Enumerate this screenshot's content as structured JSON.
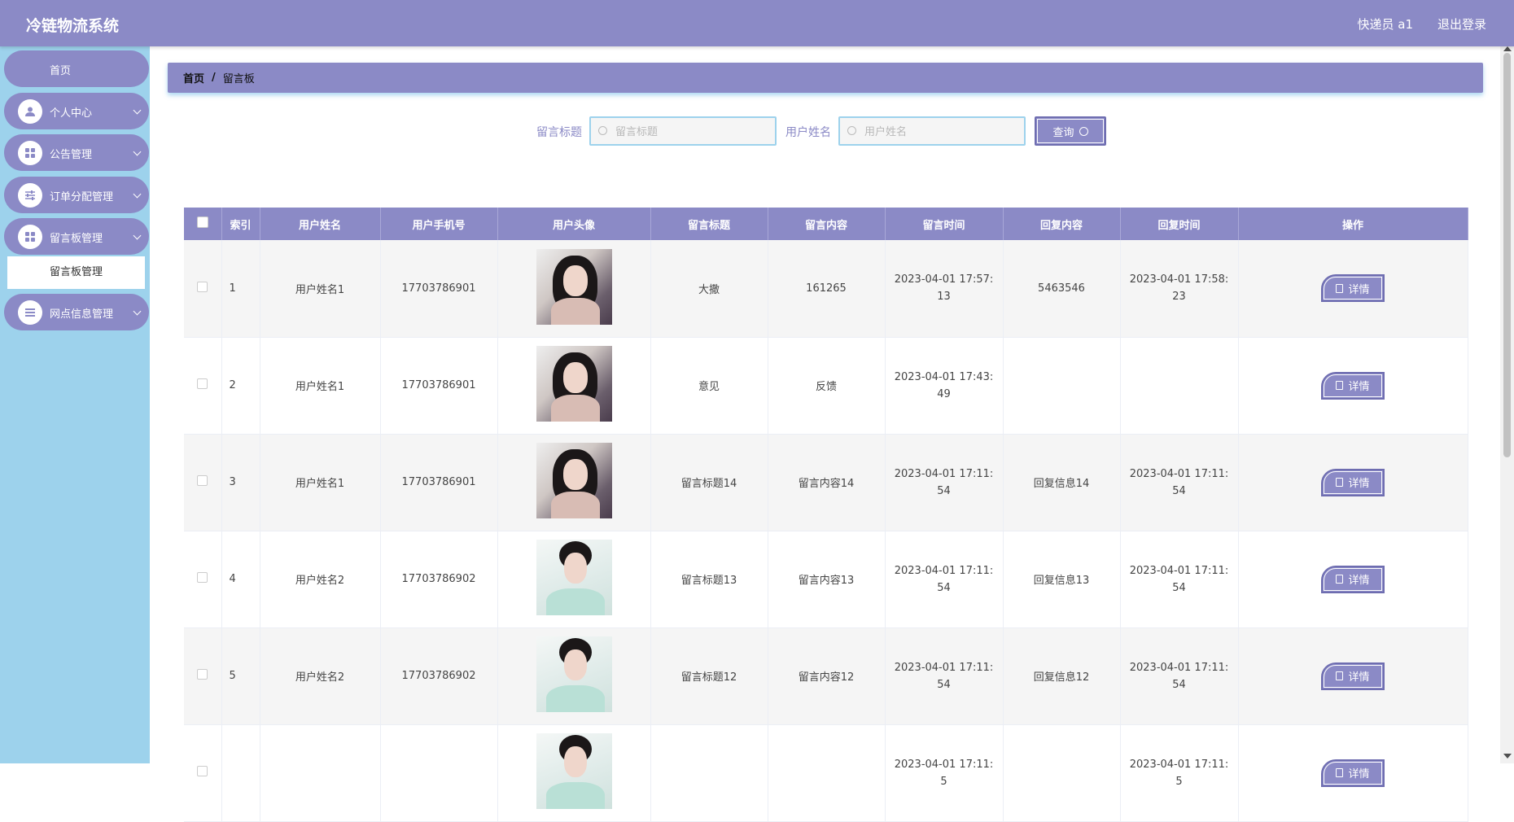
{
  "header": {
    "app_title": "冷链物流系统",
    "user_info": "快递员 a1",
    "logout": "退出登录",
    "bg_color": "#8b8ac6"
  },
  "sidebar": {
    "items": [
      {
        "label": "首页"
      },
      {
        "label": "个人中心",
        "icon": "user-icon"
      },
      {
        "label": "公告管理",
        "icon": "grid-icon"
      },
      {
        "label": "订单分配管理",
        "icon": "sliders-icon"
      },
      {
        "label": "留言板管理",
        "icon": "grid-icon"
      },
      {
        "label": "网点信息管理",
        "icon": "list-icon"
      }
    ],
    "submenu_active": "留言板管理",
    "bg_color": "#9dd2ec"
  },
  "breadcrumb": {
    "home": "首页",
    "separator": "/",
    "current": "留言板"
  },
  "search": {
    "title_label": "留言标题",
    "title_placeholder": "留言标题",
    "username_label": "用户姓名",
    "username_placeholder": "用户姓名",
    "query_button": "查询"
  },
  "table": {
    "columns": [
      "索引",
      "用户姓名",
      "用户手机号",
      "用户头像",
      "留言标题",
      "留言内容",
      "留言时间",
      "回复内容",
      "回复时间",
      "操作"
    ],
    "detail_label": "详情",
    "rows": [
      {
        "index": "1",
        "username": "用户姓名1",
        "phone": "17703786901",
        "avatar": "dark",
        "title": "大撒",
        "content": "161265",
        "time": "2023-04-01 17:57:13",
        "reply": "5463546",
        "reply_time": "2023-04-01 17:58:23"
      },
      {
        "index": "2",
        "username": "用户姓名1",
        "phone": "17703786901",
        "avatar": "dark",
        "title": "意见",
        "content": "反馈",
        "time": "2023-04-01 17:43:49",
        "reply": "",
        "reply_time": ""
      },
      {
        "index": "3",
        "username": "用户姓名1",
        "phone": "17703786901",
        "avatar": "dark",
        "title": "留言标题14",
        "content": "留言内容14",
        "time": "2023-04-01 17:11:54",
        "reply": "回复信息14",
        "reply_time": "2023-04-01 17:11:54"
      },
      {
        "index": "4",
        "username": "用户姓名2",
        "phone": "17703786902",
        "avatar": "light",
        "title": "留言标题13",
        "content": "留言内容13",
        "time": "2023-04-01 17:11:54",
        "reply": "回复信息13",
        "reply_time": "2023-04-01 17:11:54"
      },
      {
        "index": "5",
        "username": "用户姓名2",
        "phone": "17703786902",
        "avatar": "light",
        "title": "留言标题12",
        "content": "留言内容12",
        "time": "2023-04-01 17:11:54",
        "reply": "回复信息12",
        "reply_time": "2023-04-01 17:11:54"
      },
      {
        "index": "",
        "username": "",
        "phone": "",
        "avatar": "light",
        "title": "",
        "content": "",
        "time": "2023-04-01 17:11:5",
        "reply": "",
        "reply_time": "2023-04-01 17:11:5"
      }
    ]
  }
}
